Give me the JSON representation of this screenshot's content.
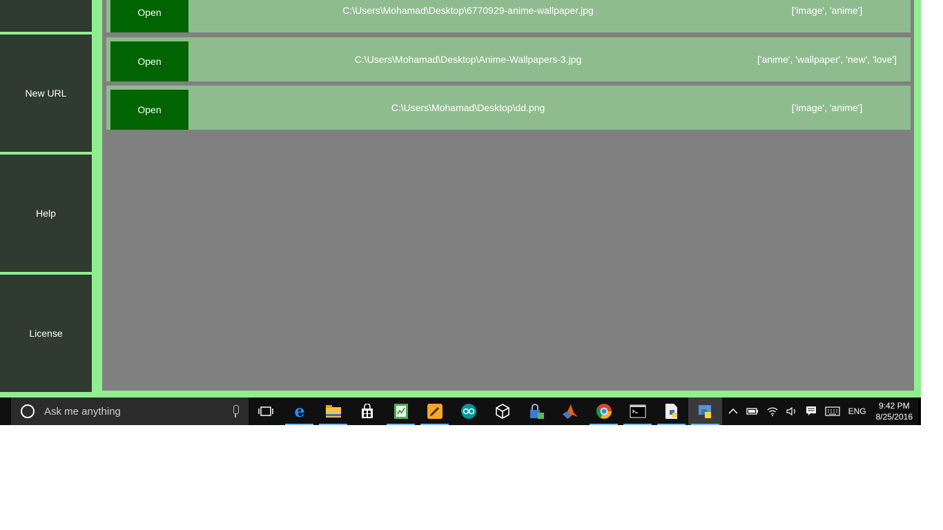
{
  "sidebar": {
    "items": [
      {
        "label": ""
      },
      {
        "label": "New URL"
      },
      {
        "label": "Help"
      },
      {
        "label": "License"
      }
    ]
  },
  "entries": [
    {
      "open_label": "Open",
      "path": "C:\\Users\\Mohamad\\Desktop\\6770929-anime-wallpaper.jpg",
      "tags": "['image', 'anime']"
    },
    {
      "open_label": "Open",
      "path": "C:\\Users\\Mohamad\\Desktop\\Anime-Wallpapers-3.jpg",
      "tags": "['anime', 'wallpaper', 'new', 'love']"
    },
    {
      "open_label": "Open",
      "path": "C:\\Users\\Mohamad\\Desktop\\dd.png",
      "tags": "['image', 'anime']"
    }
  ],
  "taskbar": {
    "search_placeholder": "Ask me anything",
    "apps": [
      {
        "icon": "task-view-icon"
      },
      {
        "icon": "edge-icon"
      },
      {
        "icon": "file-explorer-icon"
      },
      {
        "icon": "store-icon"
      },
      {
        "icon": "spreadsheet-icon"
      },
      {
        "icon": "pencil-app-icon"
      },
      {
        "icon": "arduino-icon"
      },
      {
        "icon": "unity-icon"
      },
      {
        "icon": "lock-app-icon"
      },
      {
        "icon": "matlab-icon"
      },
      {
        "icon": "chrome-icon"
      },
      {
        "icon": "terminal-icon"
      },
      {
        "icon": "python-file-icon"
      },
      {
        "icon": "python-icon"
      }
    ],
    "tray": {
      "language": "ENG",
      "time": "9:42 PM",
      "date": "8/25/2016"
    }
  },
  "colors": {
    "window_bg": "#90ee90",
    "sidebar_button": "#2f3b30",
    "main_bg": "#808080",
    "row_bg": "#8fbc8f",
    "open_button": "#006400",
    "taskbar": "#101010"
  }
}
